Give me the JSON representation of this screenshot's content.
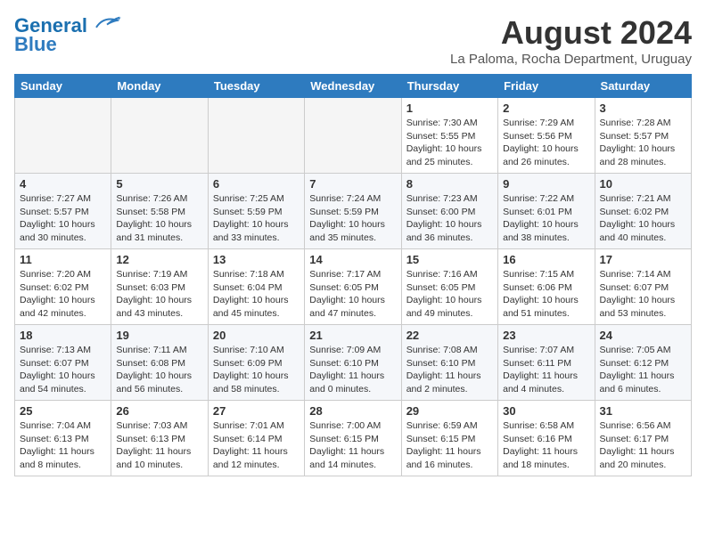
{
  "header": {
    "logo_line1": "General",
    "logo_line2": "Blue",
    "month_year": "August 2024",
    "location": "La Paloma, Rocha Department, Uruguay"
  },
  "days_of_week": [
    "Sunday",
    "Monday",
    "Tuesday",
    "Wednesday",
    "Thursday",
    "Friday",
    "Saturday"
  ],
  "weeks": [
    [
      {
        "day": "",
        "empty": true
      },
      {
        "day": "",
        "empty": true
      },
      {
        "day": "",
        "empty": true
      },
      {
        "day": "",
        "empty": true
      },
      {
        "day": "1",
        "sunrise": "7:30 AM",
        "sunset": "5:55 PM",
        "daylight": "10 hours and 25 minutes."
      },
      {
        "day": "2",
        "sunrise": "7:29 AM",
        "sunset": "5:56 PM",
        "daylight": "10 hours and 26 minutes."
      },
      {
        "day": "3",
        "sunrise": "7:28 AM",
        "sunset": "5:57 PM",
        "daylight": "10 hours and 28 minutes."
      }
    ],
    [
      {
        "day": "4",
        "sunrise": "7:27 AM",
        "sunset": "5:57 PM",
        "daylight": "10 hours and 30 minutes."
      },
      {
        "day": "5",
        "sunrise": "7:26 AM",
        "sunset": "5:58 PM",
        "daylight": "10 hours and 31 minutes."
      },
      {
        "day": "6",
        "sunrise": "7:25 AM",
        "sunset": "5:59 PM",
        "daylight": "10 hours and 33 minutes."
      },
      {
        "day": "7",
        "sunrise": "7:24 AM",
        "sunset": "5:59 PM",
        "daylight": "10 hours and 35 minutes."
      },
      {
        "day": "8",
        "sunrise": "7:23 AM",
        "sunset": "6:00 PM",
        "daylight": "10 hours and 36 minutes."
      },
      {
        "day": "9",
        "sunrise": "7:22 AM",
        "sunset": "6:01 PM",
        "daylight": "10 hours and 38 minutes."
      },
      {
        "day": "10",
        "sunrise": "7:21 AM",
        "sunset": "6:02 PM",
        "daylight": "10 hours and 40 minutes."
      }
    ],
    [
      {
        "day": "11",
        "sunrise": "7:20 AM",
        "sunset": "6:02 PM",
        "daylight": "10 hours and 42 minutes."
      },
      {
        "day": "12",
        "sunrise": "7:19 AM",
        "sunset": "6:03 PM",
        "daylight": "10 hours and 43 minutes."
      },
      {
        "day": "13",
        "sunrise": "7:18 AM",
        "sunset": "6:04 PM",
        "daylight": "10 hours and 45 minutes."
      },
      {
        "day": "14",
        "sunrise": "7:17 AM",
        "sunset": "6:05 PM",
        "daylight": "10 hours and 47 minutes."
      },
      {
        "day": "15",
        "sunrise": "7:16 AM",
        "sunset": "6:05 PM",
        "daylight": "10 hours and 49 minutes."
      },
      {
        "day": "16",
        "sunrise": "7:15 AM",
        "sunset": "6:06 PM",
        "daylight": "10 hours and 51 minutes."
      },
      {
        "day": "17",
        "sunrise": "7:14 AM",
        "sunset": "6:07 PM",
        "daylight": "10 hours and 53 minutes."
      }
    ],
    [
      {
        "day": "18",
        "sunrise": "7:13 AM",
        "sunset": "6:07 PM",
        "daylight": "10 hours and 54 minutes."
      },
      {
        "day": "19",
        "sunrise": "7:11 AM",
        "sunset": "6:08 PM",
        "daylight": "10 hours and 56 minutes."
      },
      {
        "day": "20",
        "sunrise": "7:10 AM",
        "sunset": "6:09 PM",
        "daylight": "10 hours and 58 minutes."
      },
      {
        "day": "21",
        "sunrise": "7:09 AM",
        "sunset": "6:10 PM",
        "daylight": "11 hours and 0 minutes."
      },
      {
        "day": "22",
        "sunrise": "7:08 AM",
        "sunset": "6:10 PM",
        "daylight": "11 hours and 2 minutes."
      },
      {
        "day": "23",
        "sunrise": "7:07 AM",
        "sunset": "6:11 PM",
        "daylight": "11 hours and 4 minutes."
      },
      {
        "day": "24",
        "sunrise": "7:05 AM",
        "sunset": "6:12 PM",
        "daylight": "11 hours and 6 minutes."
      }
    ],
    [
      {
        "day": "25",
        "sunrise": "7:04 AM",
        "sunset": "6:13 PM",
        "daylight": "11 hours and 8 minutes."
      },
      {
        "day": "26",
        "sunrise": "7:03 AM",
        "sunset": "6:13 PM",
        "daylight": "11 hours and 10 minutes."
      },
      {
        "day": "27",
        "sunrise": "7:01 AM",
        "sunset": "6:14 PM",
        "daylight": "11 hours and 12 minutes."
      },
      {
        "day": "28",
        "sunrise": "7:00 AM",
        "sunset": "6:15 PM",
        "daylight": "11 hours and 14 minutes."
      },
      {
        "day": "29",
        "sunrise": "6:59 AM",
        "sunset": "6:15 PM",
        "daylight": "11 hours and 16 minutes."
      },
      {
        "day": "30",
        "sunrise": "6:58 AM",
        "sunset": "6:16 PM",
        "daylight": "11 hours and 18 minutes."
      },
      {
        "day": "31",
        "sunrise": "6:56 AM",
        "sunset": "6:17 PM",
        "daylight": "11 hours and 20 minutes."
      }
    ]
  ],
  "labels": {
    "sunrise": "Sunrise:",
    "sunset": "Sunset:",
    "daylight": "Daylight:"
  }
}
